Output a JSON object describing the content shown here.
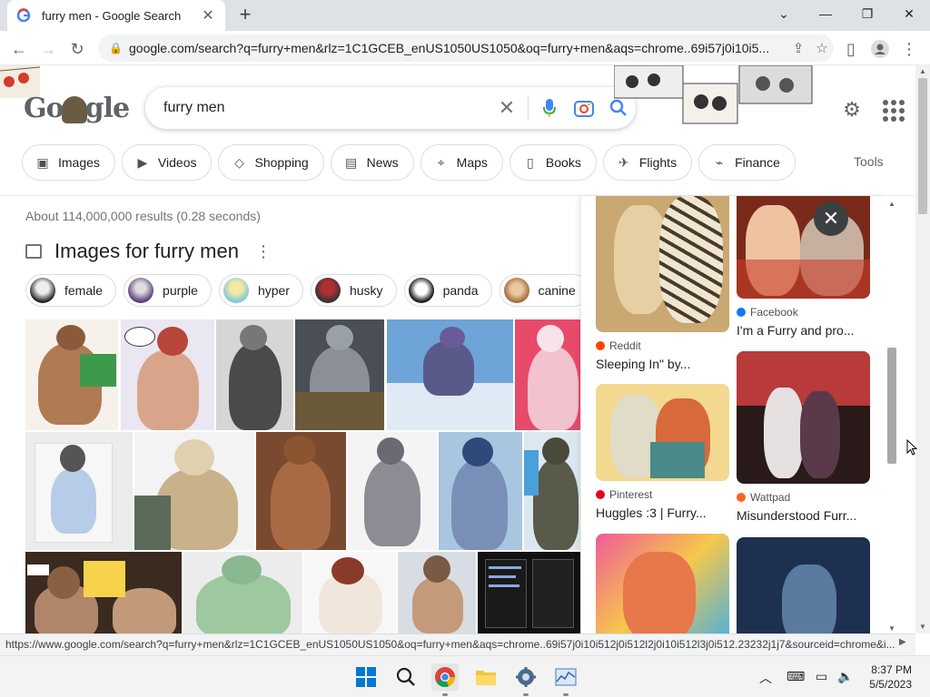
{
  "browser": {
    "tab_title": "furry men - Google Search",
    "tab_close": "✕",
    "new_tab": "+",
    "url": "google.com/search?q=furry+men&rlz=1C1GCEB_enUS1050US1050&oq=furry+men&aqs=chrome..69i57j0i10i5...",
    "window_controls": [
      "minimize",
      "maximize",
      "close"
    ]
  },
  "search": {
    "query": "furry men",
    "nav": [
      {
        "label": "Images",
        "icon": "image-icon"
      },
      {
        "label": "Videos",
        "icon": "play-icon"
      },
      {
        "label": "Shopping",
        "icon": "tag-icon"
      },
      {
        "label": "News",
        "icon": "news-icon"
      },
      {
        "label": "Maps",
        "icon": "pin-icon"
      },
      {
        "label": "Books",
        "icon": "book-icon"
      },
      {
        "label": "Flights",
        "icon": "plane-icon"
      },
      {
        "label": "Finance",
        "icon": "chart-icon"
      }
    ],
    "tools": "Tools"
  },
  "results": {
    "stats": "About 114,000,000 results (0.28 seconds)",
    "images_heading": "Images for furry men",
    "refine_chips": [
      "female",
      "purple",
      "hyper",
      "husky",
      "panda",
      "canine"
    ]
  },
  "panel": {
    "cards": [
      {
        "source": "Reddit",
        "title": "Sleeping In\" by...",
        "source_color": "#ff4500"
      },
      {
        "source": "Facebook",
        "title": "I'm a Furry and pro...",
        "source_color": "#1877f2"
      },
      {
        "source": "Pinterest",
        "title": "Huggles :3 | Furry...",
        "source_color": "#e60023"
      },
      {
        "source": "Wattpad",
        "title": "Misunderstood Furr...",
        "source_color": "#ff6122"
      }
    ]
  },
  "status_bar": {
    "url": "https://www.google.com/search?q=furry+men&rlz=1C1GCEB_enUS1050US1050&oq=furry+men&aqs=chrome..69i57j0i10i512j0i512l2j0i10i512l3j0i512.23232j1j7&sourceid=chrome&i..."
  },
  "taskbar": {
    "time": "8:37 PM",
    "date": "5/5/2023"
  },
  "colors": {
    "google_blue": "#4285f4",
    "google_red": "#ea4335",
    "google_yellow": "#fbbc05",
    "google_green": "#34a853"
  }
}
